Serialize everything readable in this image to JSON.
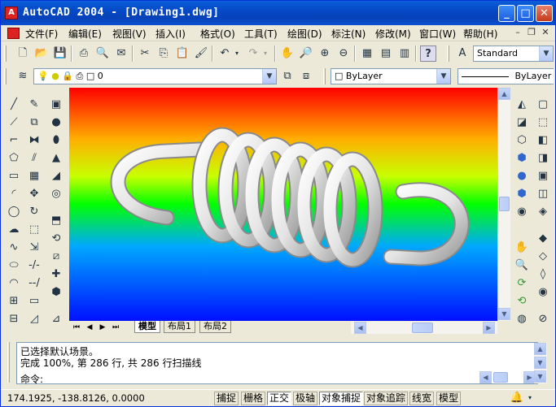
{
  "window": {
    "title": "AutoCAD 2004 - [Drawing1.dwg]",
    "minimize": "_",
    "maximize": "□",
    "close": "✕"
  },
  "menu": {
    "items": [
      "文件(F)",
      "编辑(E)",
      "视图(V)",
      "插入(I)",
      "格式(O)",
      "工具(T)",
      "绘图(D)",
      "标注(N)",
      "修改(M)",
      "窗口(W)",
      "帮助(H)"
    ],
    "mdi_min": "–",
    "mdi_restore": "❐",
    "mdi_close": "✕"
  },
  "toolbar_standard": {
    "text_style": "Standard"
  },
  "toolbar_layers": {
    "layer_name": "0",
    "color": "ByLayer",
    "linetype": "ByLayer"
  },
  "tabs": [
    "模型",
    "布局1",
    "布局2"
  ],
  "command": {
    "line1": "已选择默认场景。",
    "line2": "完成 100%, 第 286 行, 共 286 行扫描线",
    "prompt": "命令:"
  },
  "status": {
    "coords": "174.1925, -138.8126, 0.0000",
    "buttons": [
      "捕捉",
      "栅格",
      "正交",
      "极轴",
      "对象捕捉",
      "对象追踪",
      "线宽",
      "模型"
    ]
  },
  "icons": {
    "app": "autocad-icon",
    "spring": "rendered-spring"
  }
}
